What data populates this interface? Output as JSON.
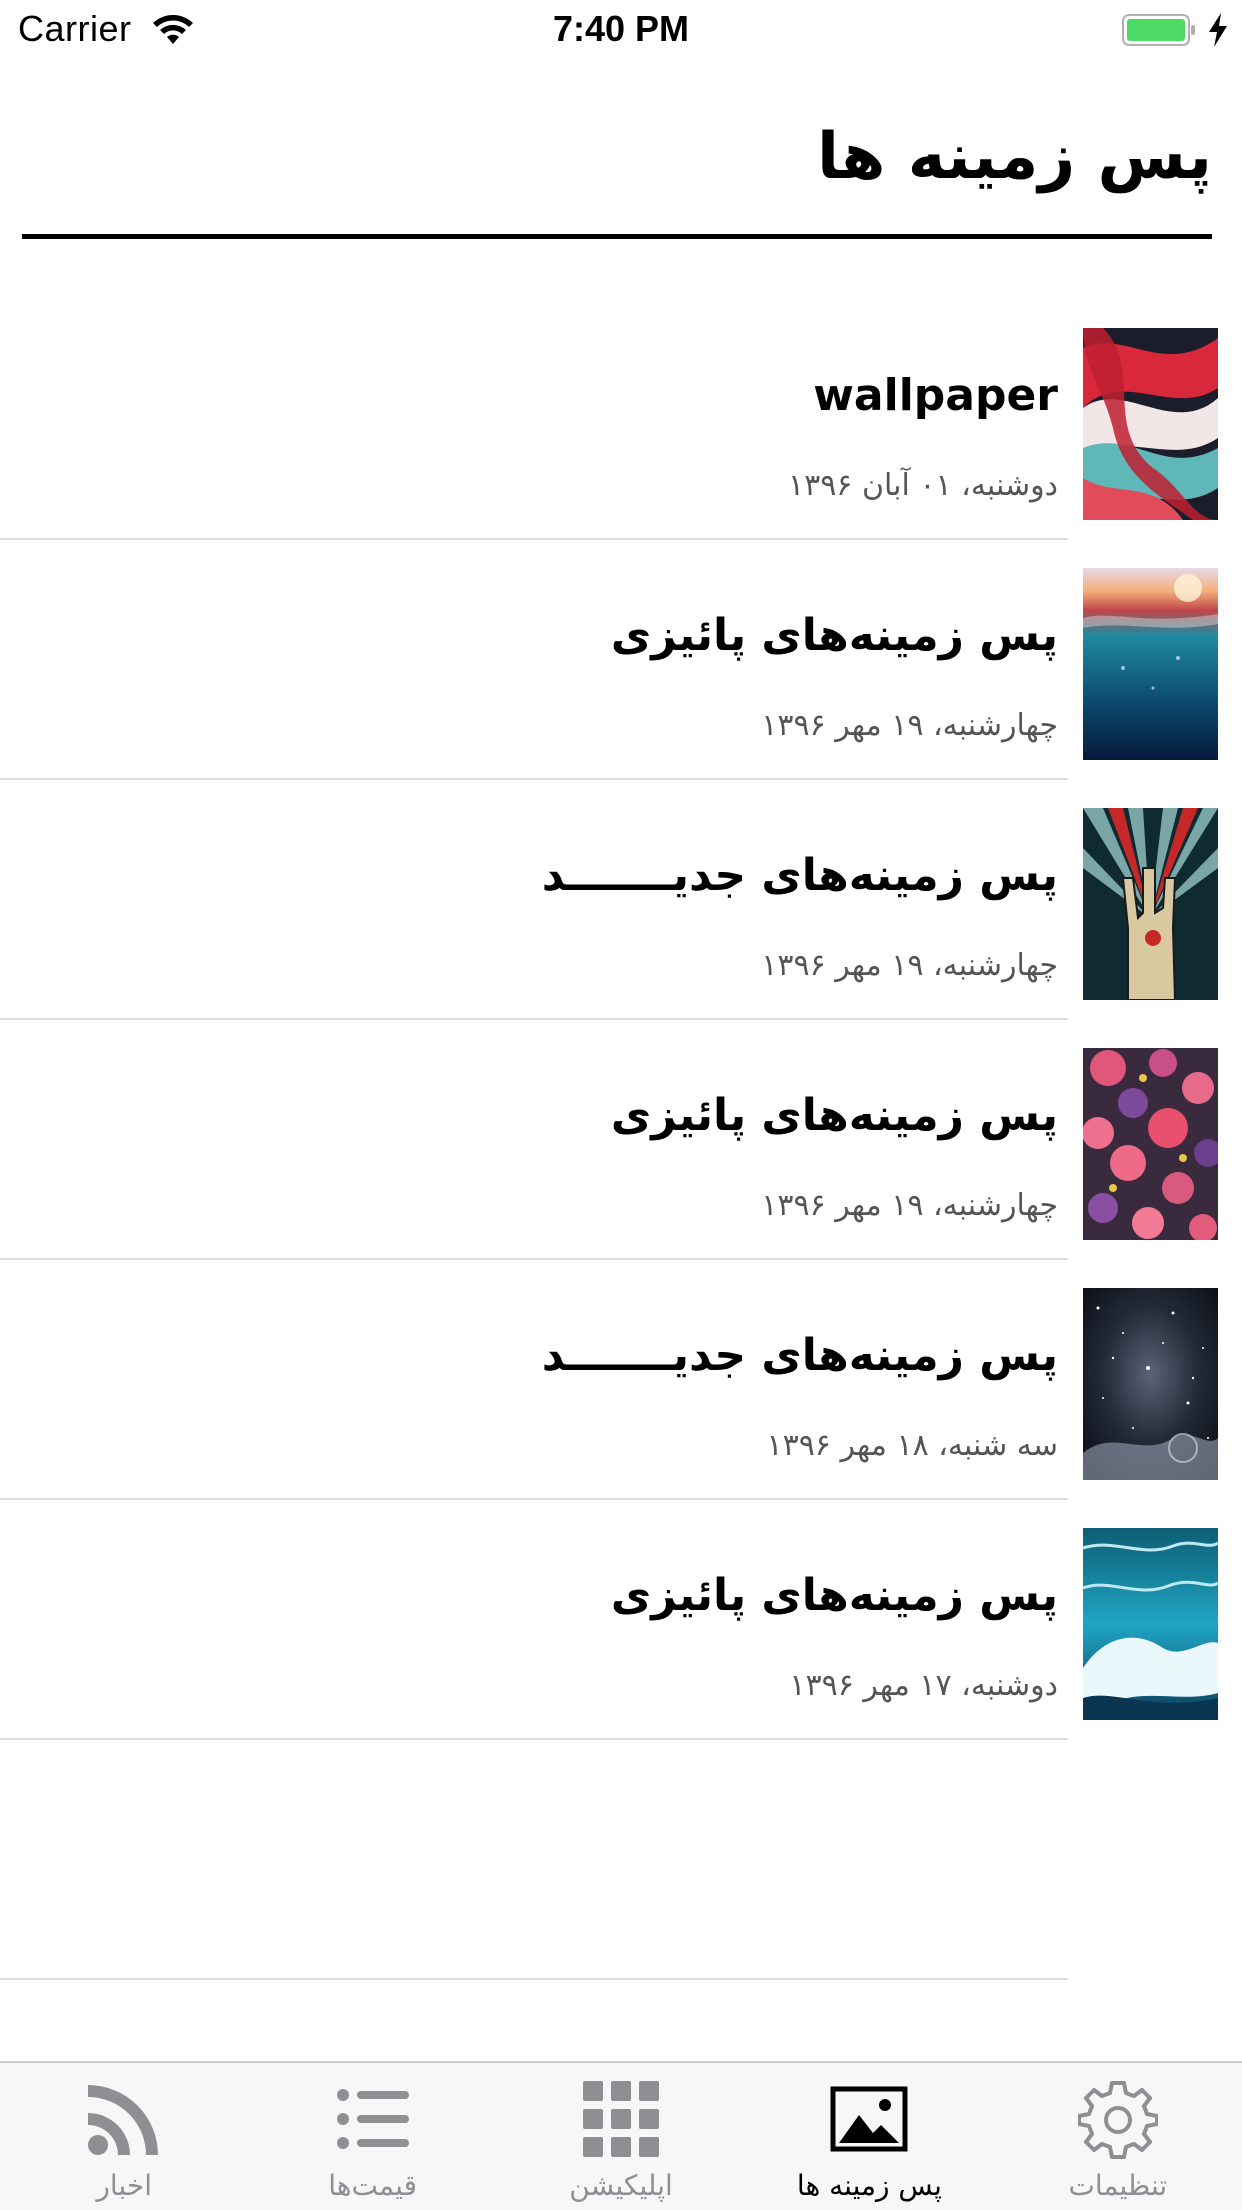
{
  "status_bar": {
    "carrier": "Carrier",
    "time": "7:40 PM",
    "battery_color": "#4cd964"
  },
  "header": {
    "title": "پس زمینه ها"
  },
  "list": {
    "items": [
      {
        "title": "wallpaper",
        "date": "دوشنبه، ۰۱ آبان ۱۳۹۶",
        "thumb": "abstract-swirl-thumbnail"
      },
      {
        "title": "پس زمینه‌های پائیزی",
        "date": "چهارشنبه، ۱۹ مهر ۱۳۹۶",
        "thumb": "underwater-sunset-thumbnail"
      },
      {
        "title": "پس زمینه‌های جدیـــــــد",
        "date": "چهارشنبه، ۱۹ مهر ۱۳۹۶",
        "thumb": "rock-hand-poster-thumbnail"
      },
      {
        "title": "پس زمینه‌های پائیزی",
        "date": "چهارشنبه، ۱۹ مهر ۱۳۹۶",
        "thumb": "flowers-thumbnail"
      },
      {
        "title": "پس زمینه‌های جدیـــــــد",
        "date": "سه شنبه، ۱۸ مهر ۱۳۹۶",
        "thumb": "galaxy-thumbnail"
      },
      {
        "title": "پس زمینه‌های پائیزی",
        "date": "دوشنبه، ۱۷ مهر ۱۳۹۶",
        "thumb": "ocean-wave-thumbnail"
      }
    ]
  },
  "tab_bar": {
    "active_index": 3,
    "tabs": [
      {
        "label": "اخبار",
        "icon": "rss-icon"
      },
      {
        "label": "قیمت‌ها",
        "icon": "list-icon"
      },
      {
        "label": "اپلیکیشن",
        "icon": "grid-icon"
      },
      {
        "label": "پس زمینه ها",
        "icon": "image-icon"
      },
      {
        "label": "تنظیمات",
        "icon": "gear-icon"
      }
    ]
  }
}
